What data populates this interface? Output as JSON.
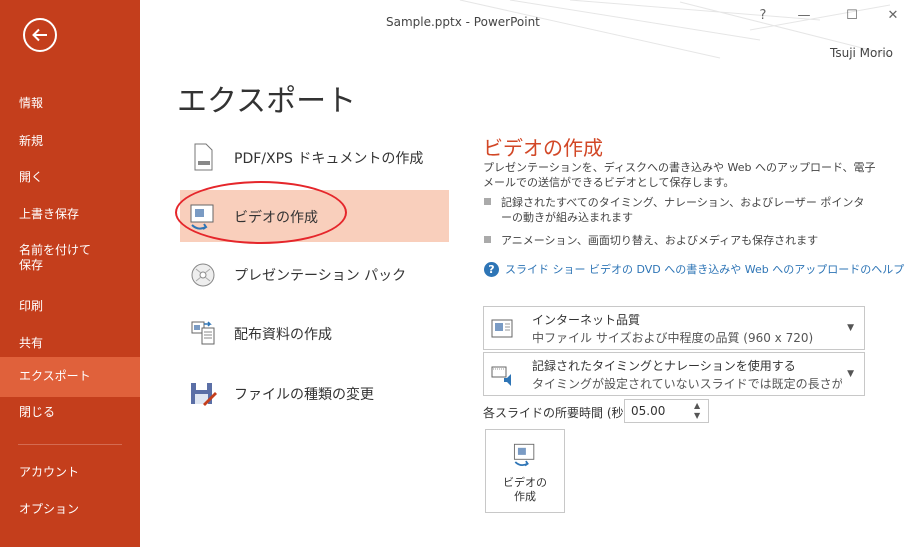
{
  "window": {
    "title": "Sample.pptx - PowerPoint",
    "help_glyph": "?",
    "minimize_glyph": "—",
    "maximize_glyph": "☐",
    "close_glyph": "✕",
    "user": "Tsuji Morio"
  },
  "sidebar": {
    "bg_color": "#c43e1c",
    "active_color": "#e0613b",
    "items": [
      {
        "label": "情報"
      },
      {
        "label": "新規"
      },
      {
        "label": "開く"
      },
      {
        "label": "上書き保存"
      },
      {
        "label": "名前を付けて\n保存"
      },
      {
        "label": "印刷"
      },
      {
        "label": "共有"
      },
      {
        "label": "エクスポート",
        "active": true
      },
      {
        "label": "閉じる"
      },
      {
        "label": "アカウント"
      },
      {
        "label": "オプション"
      }
    ]
  },
  "main": {
    "title": "エクスポート",
    "options": [
      {
        "label": "PDF/XPS ドキュメントの作成",
        "icon": "pdf-document-icon"
      },
      {
        "label": "ビデオの作成",
        "icon": "video-icon",
        "selected": true
      },
      {
        "label": "プレゼンテーション パック",
        "icon": "cd-package-icon"
      },
      {
        "label": "配布資料の作成",
        "icon": "handout-icon"
      },
      {
        "label": "ファイルの種類の変更",
        "icon": "change-filetype-icon"
      }
    ]
  },
  "detail": {
    "title": "ビデオの作成",
    "description": "プレゼンテーションを、ディスクへの書き込みや Web へのアップロード、電子メールでの送信ができるビデオとして保存します。",
    "bullets": [
      "記録されたすべてのタイミング、ナレーション、およびレーザー ポインターの動きが組み込まれます",
      "アニメーション、画面切り替え、およびメディアも保存されます"
    ],
    "help_link": "スライド ショー ビデオの DVD への書き込みや Web へのアップロードのヘルプ",
    "quality_dropdown": {
      "title": "インターネット品質",
      "subtitle": "中ファイル サイズおよび中程度の品質 (960 x 720)"
    },
    "timing_dropdown": {
      "title": "記録されたタイミングとナレーションを使用する",
      "subtitle": "タイミングが設定されていないスライドでは既定の長さが使わ…"
    },
    "duration_label": "各スライドの所要時間 (秒):",
    "duration_value": "05.00",
    "create_button": "ビデオの\n作成",
    "accent_color": "#d24726",
    "link_color": "#2e75b6"
  }
}
